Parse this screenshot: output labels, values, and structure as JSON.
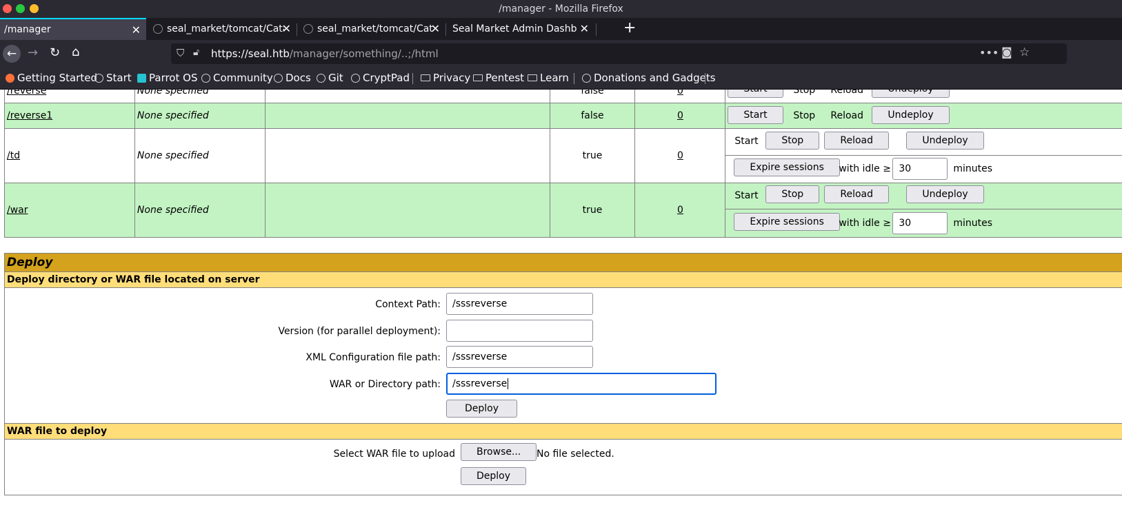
{
  "window": {
    "title": "/manager - Mozilla Firefox"
  },
  "tabs": [
    {
      "label": "/manager"
    },
    {
      "label": "seal_market/tomcat/Cata"
    },
    {
      "label": "seal_market/tomcat/Cata"
    },
    {
      "label": "Seal Market Admin Dashboa"
    }
  ],
  "url": {
    "host": "https://seal.htb",
    "path": "/manager/something/..;/html"
  },
  "bookmarks": [
    "Getting Started",
    "Start",
    "Parrot OS",
    "Community",
    "Docs",
    "Git",
    "CryptPad",
    "Privacy",
    "Pentest",
    "Learn",
    "Donations and Gadgets"
  ],
  "apps": {
    "rows": [
      {
        "path": "/reverse",
        "name": "None specified",
        "running": "false",
        "sessions": "0"
      },
      {
        "path": "/reverse1",
        "name": "None specified",
        "running": "false",
        "sessions": "0"
      },
      {
        "path": "/td",
        "name": "None specified",
        "running": "true",
        "sessions": "0"
      },
      {
        "path": "/war",
        "name": "None specified",
        "running": "true",
        "sessions": "0"
      }
    ],
    "ops": {
      "start": "Start",
      "stop": "Stop",
      "reload": "Reload",
      "undeploy": "Undeploy",
      "expire": "Expire sessions",
      "with_idle": "with idle ≥",
      "idle_value": "30",
      "minutes": "minutes"
    }
  },
  "deploy": {
    "heading": "Deploy",
    "server_section": "Deploy directory or WAR file located on server",
    "context_label": "Context Path:",
    "context_value": "/sssreverse",
    "version_label": "Version (for parallel deployment):",
    "version_value": "",
    "xml_label": "XML Configuration file path:",
    "xml_value": "/sssreverse",
    "war_label": "WAR or Directory path:",
    "war_value": "/sssreverse",
    "deploy_button": "Deploy",
    "upload_section": "WAR file to deploy",
    "select_label": "Select WAR file to upload",
    "browse_button": "Browse...",
    "no_file": "No file selected.",
    "upload_deploy_button": "Deploy"
  }
}
